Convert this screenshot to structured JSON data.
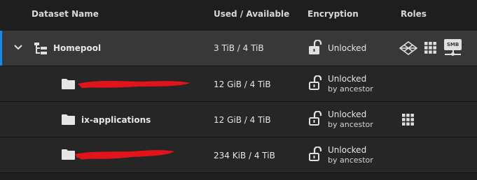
{
  "columns": {
    "name": "Dataset Name",
    "used": "Used / Available",
    "encryption": "Encryption",
    "roles": "Roles"
  },
  "accent_color": "#1e88e5",
  "rows": [
    {
      "name": "Homepool",
      "used": "3 TiB / 4 TiB",
      "encryption": "Unlocked",
      "encryption_sub": "",
      "roles": [
        "share-icon",
        "apps-grid-icon",
        "smb-share-icon"
      ],
      "smb_label": "SMB"
    },
    {
      "name": "",
      "redacted": true,
      "used": "12 GiB / 4 TiB",
      "encryption": "Unlocked",
      "encryption_sub": "by ancestor",
      "roles": []
    },
    {
      "name": "ix-applications",
      "used": "12 GiB / 4 TiB",
      "encryption": "Unlocked",
      "encryption_sub": "by ancestor",
      "roles": [
        "apps-grid-icon"
      ]
    },
    {
      "name": "",
      "redacted": true,
      "used": "234 KiB / 4 TiB",
      "encryption": "Unlocked",
      "encryption_sub": "by ancestor",
      "roles": []
    }
  ]
}
